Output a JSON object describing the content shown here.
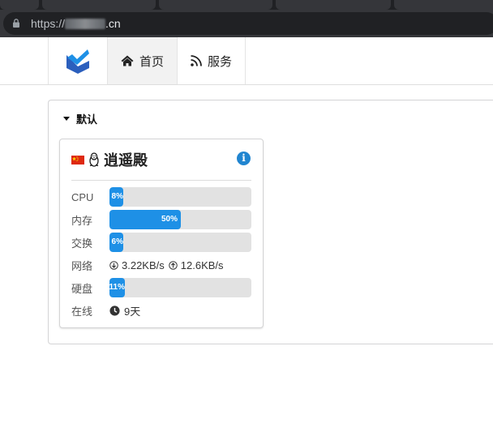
{
  "browser": {
    "url_scheme": "https://",
    "url_host": ".cn"
  },
  "nav": {
    "items": [
      {
        "label": "首页",
        "icon": "home-icon"
      },
      {
        "label": "服务",
        "icon": "rss-icon"
      }
    ]
  },
  "group": {
    "title": "默认"
  },
  "server": {
    "name": "逍遥殿",
    "flag": "china-flag",
    "os": "linux-penguin",
    "cpu_label": "CPU",
    "cpu_pct": "8%",
    "cpu_fraction": 0.08,
    "mem_label": "内存",
    "mem_pct": "50%",
    "mem_fraction": 0.5,
    "swap_label": "交换",
    "swap_pct": "6%",
    "swap_fraction": 0.06,
    "net_label": "网络",
    "net_down": "3.22KB/s",
    "net_up": "12.6KB/s",
    "disk_label": "硬盘",
    "disk_pct": "11%",
    "disk_fraction": 0.11,
    "uptime_label": "在线",
    "uptime": "9天"
  },
  "colors": {
    "accent": "#1e90e6",
    "info": "#2185d0",
    "bar_bg": "#e2e2e2"
  }
}
